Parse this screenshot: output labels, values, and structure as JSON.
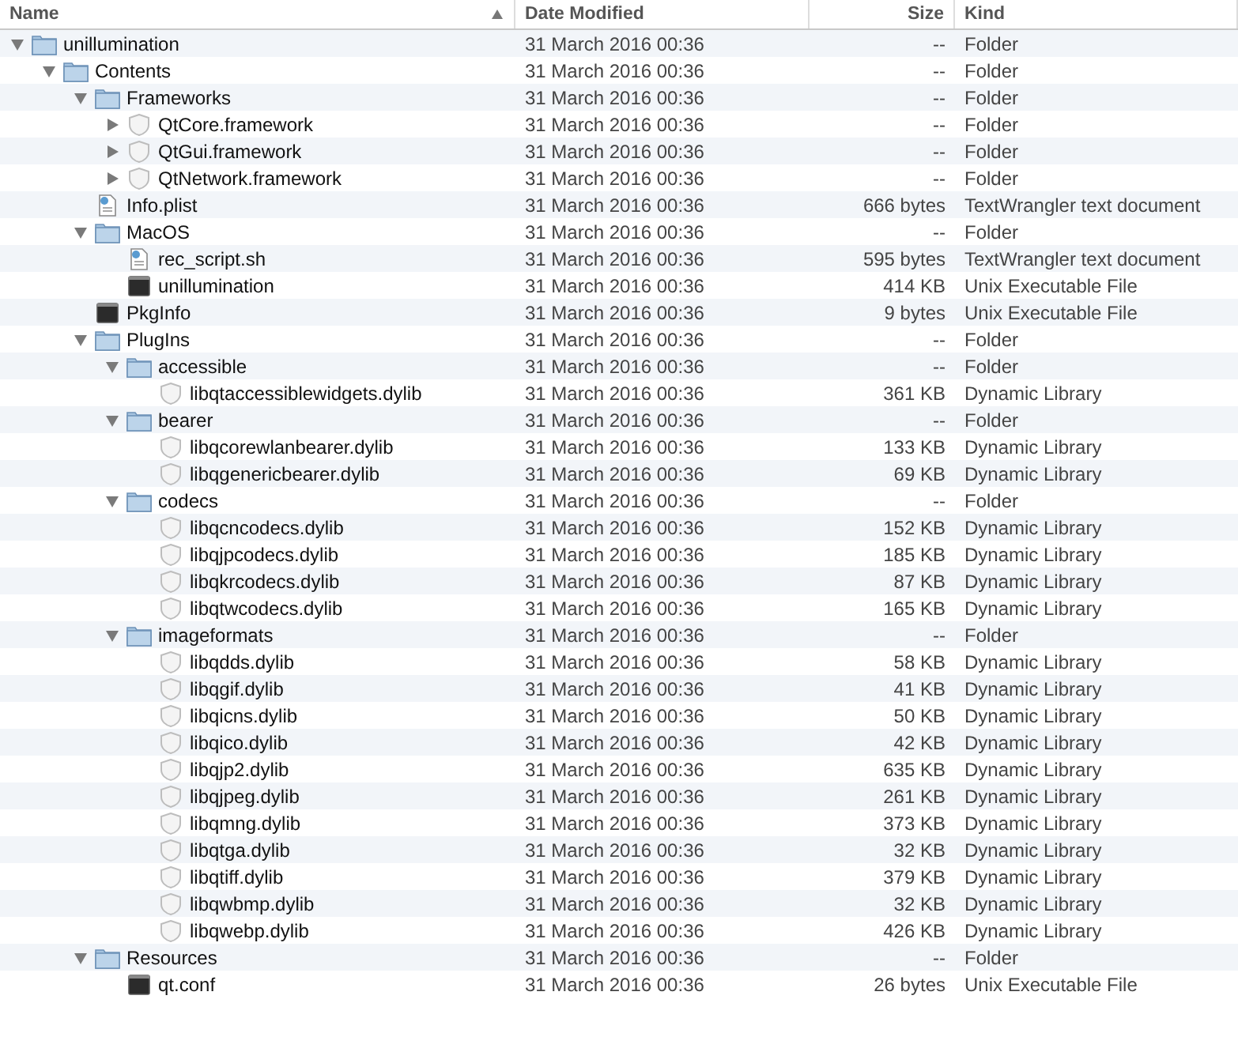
{
  "columns": [
    {
      "label": "Name",
      "sorted": true
    },
    {
      "label": "Date Modified",
      "sorted": false
    },
    {
      "label": "Size",
      "sorted": false
    },
    {
      "label": "Kind",
      "sorted": false
    }
  ],
  "rows": [
    {
      "name": "unillumination",
      "kind": "folder",
      "expanded": true,
      "date": "31 March 2016 00:36",
      "size": "--",
      "type": "Folder",
      "children": [
        {
          "name": "Contents",
          "kind": "folder",
          "expanded": true,
          "date": "31 March 2016 00:36",
          "size": "--",
          "type": "Folder",
          "children": [
            {
              "name": "Frameworks",
              "kind": "folder",
              "expanded": true,
              "date": "31 March 2016 00:36",
              "size": "--",
              "type": "Folder",
              "children": [
                {
                  "name": "QtCore.framework",
                  "kind": "bundle",
                  "expanded": false,
                  "date": "31 March 2016 00:36",
                  "size": "--",
                  "type": "Folder"
                },
                {
                  "name": "QtGui.framework",
                  "kind": "bundle",
                  "expanded": false,
                  "date": "31 March 2016 00:36",
                  "size": "--",
                  "type": "Folder"
                },
                {
                  "name": "QtNetwork.framework",
                  "kind": "bundle",
                  "expanded": false,
                  "date": "31 March 2016 00:36",
                  "size": "--",
                  "type": "Folder"
                }
              ]
            },
            {
              "name": "Info.plist",
              "kind": "document",
              "date": "31 March 2016 00:36",
              "size": "666 bytes",
              "type": "TextWrangler text document"
            },
            {
              "name": "MacOS",
              "kind": "folder",
              "expanded": true,
              "date": "31 March 2016 00:36",
              "size": "--",
              "type": "Folder",
              "children": [
                {
                  "name": "rec_script.sh",
                  "kind": "document",
                  "date": "31 March 2016 00:36",
                  "size": "595 bytes",
                  "type": "TextWrangler text document"
                },
                {
                  "name": "unillumination",
                  "kind": "executable",
                  "date": "31 March 2016 00:36",
                  "size": "414 KB",
                  "type": "Unix Executable File"
                }
              ]
            },
            {
              "name": "PkgInfo",
              "kind": "executable",
              "date": "31 March 2016 00:36",
              "size": "9 bytes",
              "type": "Unix Executable File"
            },
            {
              "name": "PlugIns",
              "kind": "folder",
              "expanded": true,
              "date": "31 March 2016 00:36",
              "size": "--",
              "type": "Folder",
              "children": [
                {
                  "name": "accessible",
                  "kind": "folder",
                  "expanded": true,
                  "date": "31 March 2016 00:36",
                  "size": "--",
                  "type": "Folder",
                  "children": [
                    {
                      "name": "libqtaccessiblewidgets.dylib",
                      "kind": "library",
                      "date": "31 March 2016 00:36",
                      "size": "361 KB",
                      "type": "Dynamic Library"
                    }
                  ]
                },
                {
                  "name": "bearer",
                  "kind": "folder",
                  "expanded": true,
                  "date": "31 March 2016 00:36",
                  "size": "--",
                  "type": "Folder",
                  "children": [
                    {
                      "name": "libqcorewlanbearer.dylib",
                      "kind": "library",
                      "date": "31 March 2016 00:36",
                      "size": "133 KB",
                      "type": "Dynamic Library"
                    },
                    {
                      "name": "libqgenericbearer.dylib",
                      "kind": "library",
                      "date": "31 March 2016 00:36",
                      "size": "69 KB",
                      "type": "Dynamic Library"
                    }
                  ]
                },
                {
                  "name": "codecs",
                  "kind": "folder",
                  "expanded": true,
                  "date": "31 March 2016 00:36",
                  "size": "--",
                  "type": "Folder",
                  "children": [
                    {
                      "name": "libqcncodecs.dylib",
                      "kind": "library",
                      "date": "31 March 2016 00:36",
                      "size": "152 KB",
                      "type": "Dynamic Library"
                    },
                    {
                      "name": "libqjpcodecs.dylib",
                      "kind": "library",
                      "date": "31 March 2016 00:36",
                      "size": "185 KB",
                      "type": "Dynamic Library"
                    },
                    {
                      "name": "libqkrcodecs.dylib",
                      "kind": "library",
                      "date": "31 March 2016 00:36",
                      "size": "87 KB",
                      "type": "Dynamic Library"
                    },
                    {
                      "name": "libqtwcodecs.dylib",
                      "kind": "library",
                      "date": "31 March 2016 00:36",
                      "size": "165 KB",
                      "type": "Dynamic Library"
                    }
                  ]
                },
                {
                  "name": "imageformats",
                  "kind": "folder",
                  "expanded": true,
                  "date": "31 March 2016 00:36",
                  "size": "--",
                  "type": "Folder",
                  "children": [
                    {
                      "name": "libqdds.dylib",
                      "kind": "library",
                      "date": "31 March 2016 00:36",
                      "size": "58 KB",
                      "type": "Dynamic Library"
                    },
                    {
                      "name": "libqgif.dylib",
                      "kind": "library",
                      "date": "31 March 2016 00:36",
                      "size": "41 KB",
                      "type": "Dynamic Library"
                    },
                    {
                      "name": "libqicns.dylib",
                      "kind": "library",
                      "date": "31 March 2016 00:36",
                      "size": "50 KB",
                      "type": "Dynamic Library"
                    },
                    {
                      "name": "libqico.dylib",
                      "kind": "library",
                      "date": "31 March 2016 00:36",
                      "size": "42 KB",
                      "type": "Dynamic Library"
                    },
                    {
                      "name": "libqjp2.dylib",
                      "kind": "library",
                      "date": "31 March 2016 00:36",
                      "size": "635 KB",
                      "type": "Dynamic Library"
                    },
                    {
                      "name": "libqjpeg.dylib",
                      "kind": "library",
                      "date": "31 March 2016 00:36",
                      "size": "261 KB",
                      "type": "Dynamic Library"
                    },
                    {
                      "name": "libqmng.dylib",
                      "kind": "library",
                      "date": "31 March 2016 00:36",
                      "size": "373 KB",
                      "type": "Dynamic Library"
                    },
                    {
                      "name": "libqtga.dylib",
                      "kind": "library",
                      "date": "31 March 2016 00:36",
                      "size": "32 KB",
                      "type": "Dynamic Library"
                    },
                    {
                      "name": "libqtiff.dylib",
                      "kind": "library",
                      "date": "31 March 2016 00:36",
                      "size": "379 KB",
                      "type": "Dynamic Library"
                    },
                    {
                      "name": "libqwbmp.dylib",
                      "kind": "library",
                      "date": "31 March 2016 00:36",
                      "size": "32 KB",
                      "type": "Dynamic Library"
                    },
                    {
                      "name": "libqwebp.dylib",
                      "kind": "library",
                      "date": "31 March 2016 00:36",
                      "size": "426 KB",
                      "type": "Dynamic Library"
                    }
                  ]
                }
              ]
            },
            {
              "name": "Resources",
              "kind": "folder",
              "expanded": true,
              "date": "31 March 2016 00:36",
              "size": "--",
              "type": "Folder",
              "children": [
                {
                  "name": "qt.conf",
                  "kind": "executable",
                  "date": "31 March 2016 00:36",
                  "size": "26 bytes",
                  "type": "Unix Executable File"
                }
              ]
            }
          ]
        }
      ]
    }
  ]
}
